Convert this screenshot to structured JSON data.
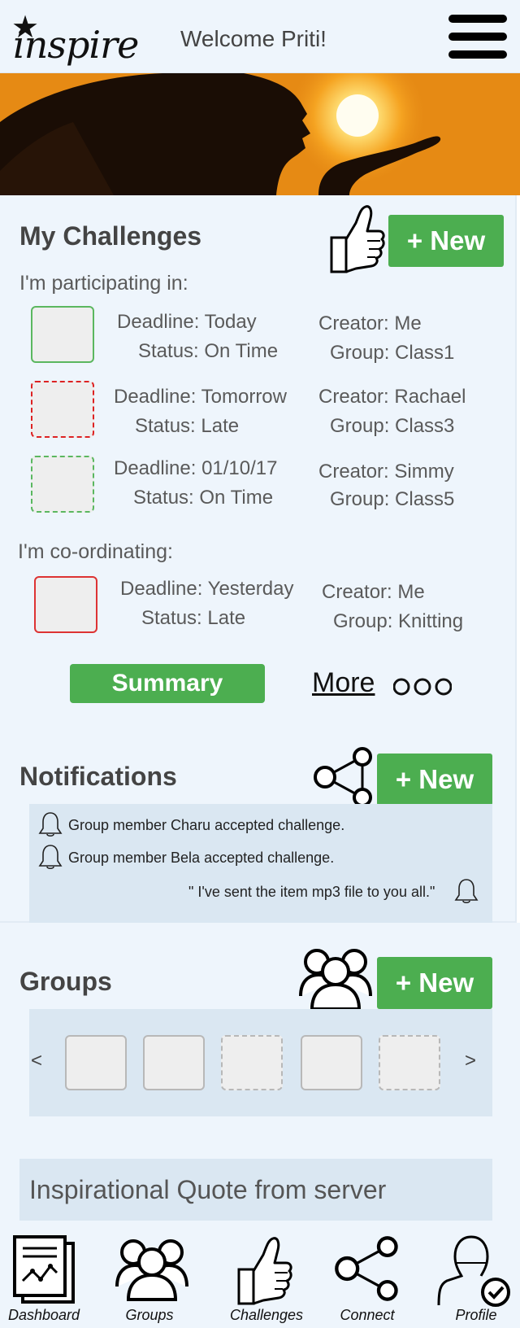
{
  "header": {
    "logo_text": "inspire",
    "welcome": "Welcome Priti!",
    "menu_icon": "hamburger-menu-icon"
  },
  "hero": {
    "description_icon": "hero-banner-image"
  },
  "challenges": {
    "title": "My Challenges",
    "new_label": "+ New",
    "participating_label": "I'm participating in:",
    "participating": [
      {
        "deadline": "Deadline: Today",
        "status": "Status: On Time",
        "creator": "Creator: Me",
        "group": "Group: Class1"
      },
      {
        "deadline": "Deadline: Tomorrow",
        "status": "Status: Late",
        "creator": "Creator: Rachael",
        "group": "Group: Class3"
      },
      {
        "deadline": "Deadline: 01/10/17",
        "status": "Status: On Time",
        "creator": "Creator: Simmy",
        "group": "Group: Class5"
      }
    ],
    "coordinating_label": "I'm co-ordinating:",
    "coordinating": [
      {
        "deadline": "Deadline: Yesterday",
        "status": "Status: Late",
        "creator": "Creator: Me",
        "group": "Group: Knitting"
      }
    ],
    "summary_label": "Summary",
    "more_label": "More"
  },
  "notifications": {
    "title": "Notifications",
    "new_label": "+ New",
    "items": [
      "Group member Charu accepted challenge.",
      "Group member Bela accepted challenge.",
      "\" I've sent the item mp3 file to you all.\""
    ]
  },
  "groups": {
    "title": "Groups",
    "new_label": "+ New",
    "prev": "<",
    "next": ">"
  },
  "quote": {
    "text": "Inspirational Quote from server"
  },
  "nav": {
    "items": [
      {
        "label": "Dashboard",
        "icon": "dashboard-icon"
      },
      {
        "label": "Groups",
        "icon": "groups-icon"
      },
      {
        "label": "Challenges",
        "icon": "thumbs-up-icon"
      },
      {
        "label": "Connect",
        "icon": "share-icon"
      },
      {
        "label": "Profile",
        "icon": "profile-icon"
      }
    ]
  },
  "colors": {
    "accent_green": "#4cae50",
    "card_bg": "#eef5fc",
    "panel_bg": "#dae7f2",
    "late_red": "#dd2222"
  }
}
